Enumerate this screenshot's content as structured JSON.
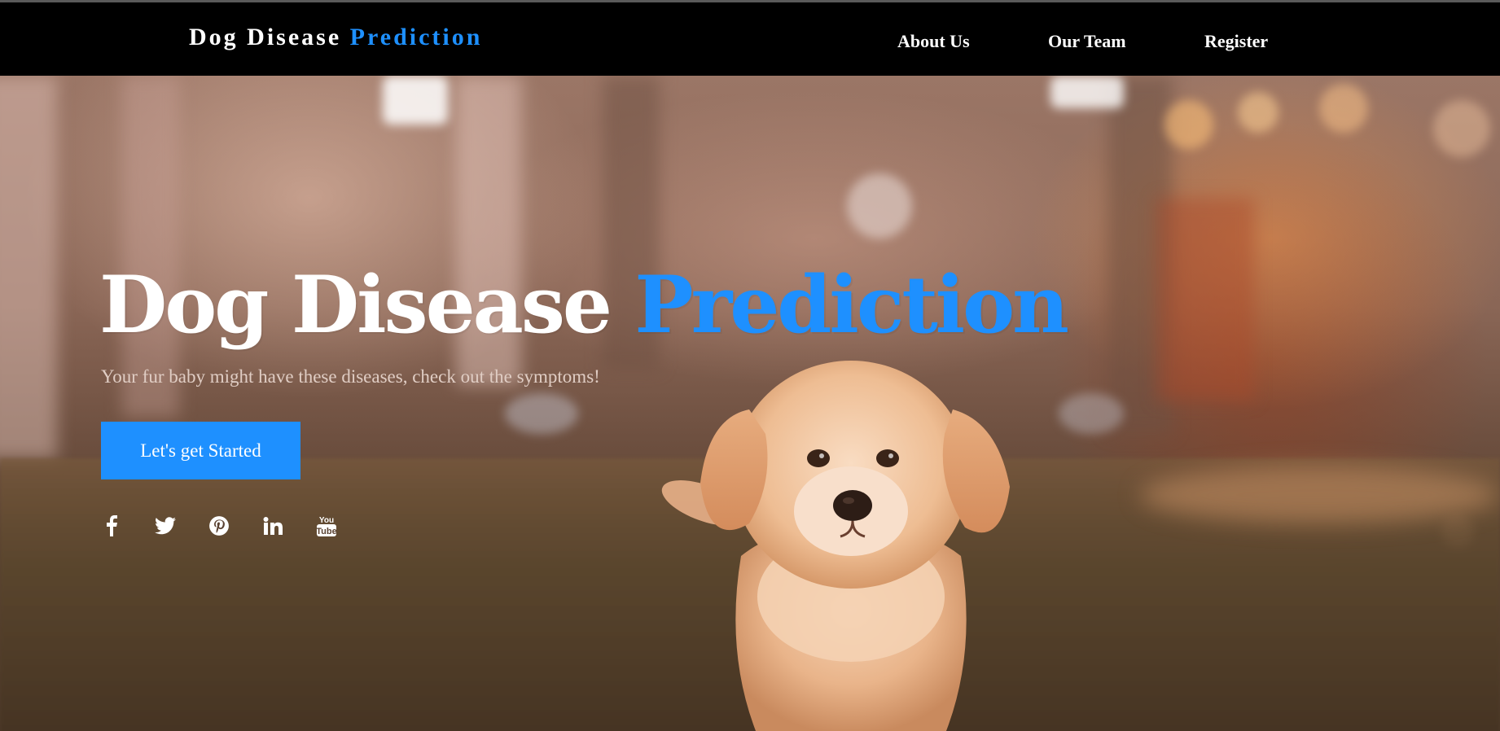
{
  "navbar": {
    "brand_main": "Dog Disease",
    "brand_accent": "Prediction",
    "links": [
      {
        "label": "About Us"
      },
      {
        "label": "Our Team"
      },
      {
        "label": "Register"
      }
    ]
  },
  "hero": {
    "title_main": "Dog Disease",
    "title_accent": "Prediction",
    "subtitle": "Your fur baby might have these diseases, check out the symptoms!",
    "cta_label": "Let's get Started",
    "social_icons": [
      "facebook-icon",
      "twitter-icon",
      "pinterest-icon",
      "linkedin-icon",
      "youtube-icon"
    ]
  },
  "colors": {
    "accent": "#1e90ff",
    "navbar_bg": "#000000",
    "text_light": "#ffffff",
    "subtitle_text": "#e0cdc4"
  }
}
